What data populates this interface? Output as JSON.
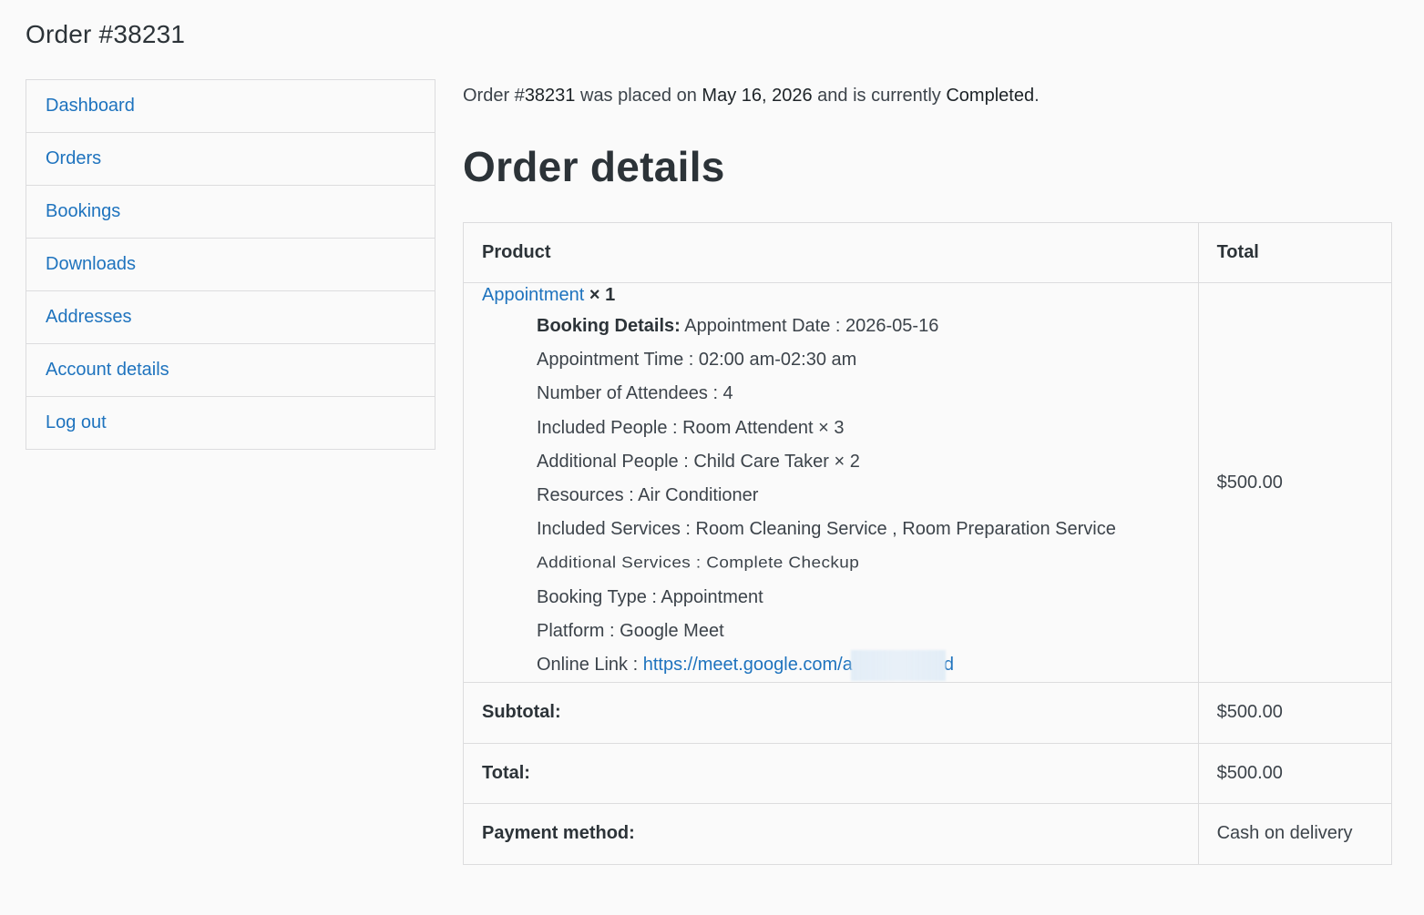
{
  "page": {
    "title": "Order #38231"
  },
  "nav": {
    "items": [
      "Dashboard",
      "Orders",
      "Bookings",
      "Downloads",
      "Addresses",
      "Account details",
      "Log out"
    ]
  },
  "status": {
    "prefix": "Order #",
    "order_number": "38231",
    "mid1": " was placed on ",
    "date": "May 16, 2026",
    "mid2": " and is currently ",
    "state": "Completed",
    "suffix": "."
  },
  "details": {
    "heading": "Order details",
    "col_product": "Product",
    "col_total": "Total",
    "item": {
      "name": "Appointment",
      "qty": "× 1",
      "total": "$500.00",
      "booking_label": "Booking Details:",
      "meta": [
        " Appointment Date : 2026-05-16",
        "Appointment Time : 02:00 am-02:30 am",
        "Number of Attendees : 4",
        "Included People : Room Attendent × 3",
        "Additional People : Child Care Taker × 2",
        "Resources : Air Conditioner",
        "Included Services : Room Cleaning Service , Room Preparation Service",
        "Additional Services : Complete Checkup",
        "Booking Type : Appointment",
        "Platform : Google Meet"
      ],
      "online_link_label": "Online Link : ",
      "online_link_start": "https://meet.google.com/a",
      "online_link_end": "d"
    },
    "footer": [
      {
        "label": "Subtotal:",
        "value": "$500.00"
      },
      {
        "label": "Total:",
        "value": "$500.00"
      },
      {
        "label": "Payment method:",
        "value": "Cash on delivery"
      }
    ]
  }
}
